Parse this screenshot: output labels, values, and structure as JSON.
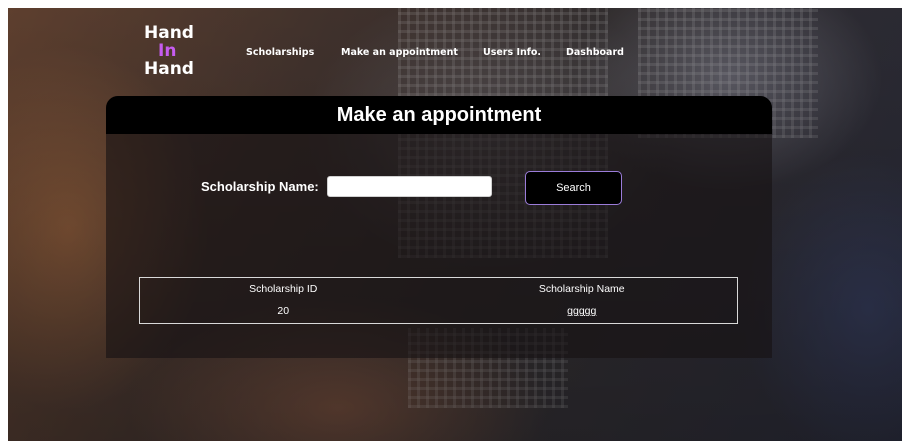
{
  "logo": {
    "line1": "Hand",
    "line2": "In",
    "line3": "Hand",
    "accent_color": "#c65cf0"
  },
  "nav": {
    "items": [
      {
        "label": "Scholarships"
      },
      {
        "label": "Make an appointment"
      },
      {
        "label": "Users Info."
      },
      {
        "label": "Dashboard"
      }
    ]
  },
  "main": {
    "title": "Make an appointment",
    "search": {
      "label": "Scholarship Name:",
      "value": "",
      "placeholder": "",
      "button_label": "Search"
    },
    "table": {
      "headers": [
        "Scholarship ID",
        "Scholarship Name"
      ],
      "rows": [
        [
          "20",
          "ggggg"
        ]
      ]
    }
  },
  "colors": {
    "button_border": "#9b7cd9",
    "header_bg": "#000000"
  }
}
